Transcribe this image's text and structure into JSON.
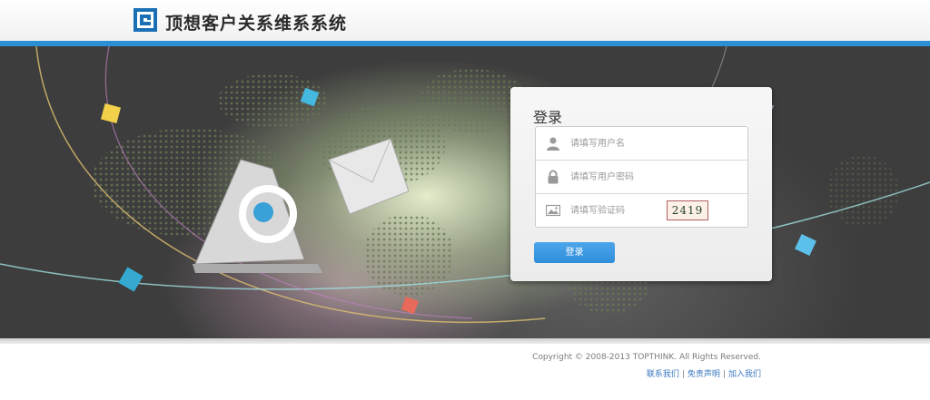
{
  "header": {
    "title": "顶想客户关系维系系统",
    "logo_icon": "topthink-logo-icon"
  },
  "login": {
    "title": "登录",
    "username_placeholder": "请填写用户名",
    "password_placeholder": "请填写用户密码",
    "captcha_placeholder": "请填写验证码",
    "captcha_text": "2419",
    "submit_label": "登录"
  },
  "footer": {
    "copyright": "Copyright © 2008-2013 TOPTHINK. All Rights Reserved.",
    "links": [
      "联系我们",
      "免责声明",
      "加入我们"
    ],
    "separator": "|"
  },
  "colors": {
    "accent": "#2b8fd6",
    "button": "#3a9be3",
    "stage_bg": "#3d3d3d"
  }
}
